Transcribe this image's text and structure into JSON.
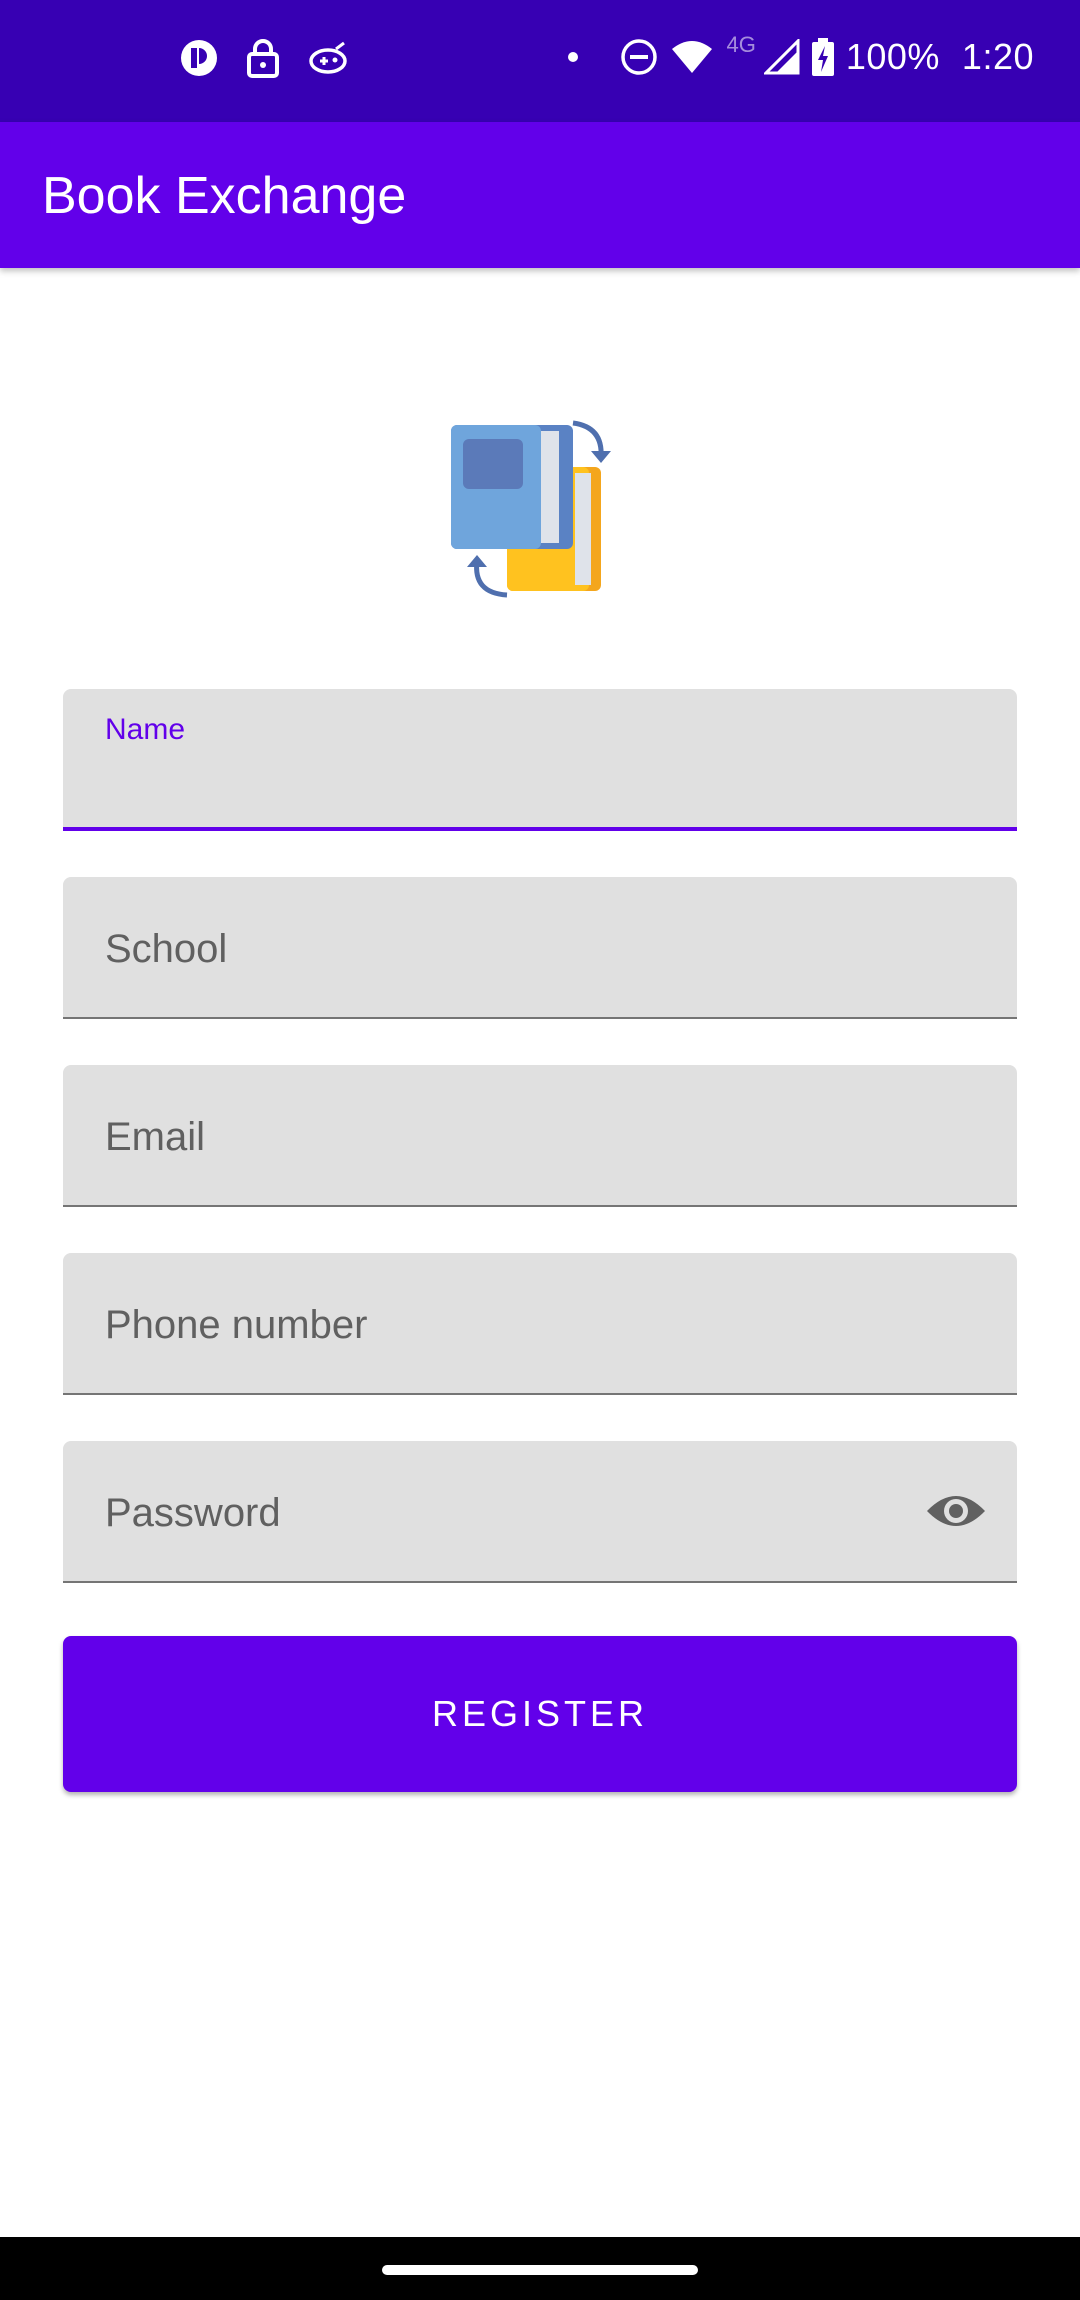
{
  "status_bar": {
    "battery": "100%",
    "time": "1:20",
    "network_type": "4G",
    "icons_left": [
      "app-notification-icon",
      "lock-icon",
      "game-controller-icon"
    ],
    "icons_right": [
      "dot-icon",
      "do-not-disturb-icon",
      "wifi-icon",
      "signal-icon",
      "battery-charging-icon"
    ]
  },
  "app_bar": {
    "title": "Book Exchange",
    "color": "#6200ea"
  },
  "logo": {
    "icon": "book-exchange-logo-icon"
  },
  "form": {
    "fields": [
      {
        "label": "Name",
        "value": "",
        "focused": true
      },
      {
        "label": "School",
        "value": ""
      },
      {
        "label": "Email",
        "value": ""
      },
      {
        "label": "Phone number",
        "value": ""
      },
      {
        "label": "Password",
        "value": "",
        "trailing_icon": "eye-icon"
      }
    ],
    "submit_label": "REGISTER"
  },
  "colors": {
    "primary": "#6200ea",
    "primary_dark": "#3700b3",
    "field_bg": "#e0e0e0"
  }
}
